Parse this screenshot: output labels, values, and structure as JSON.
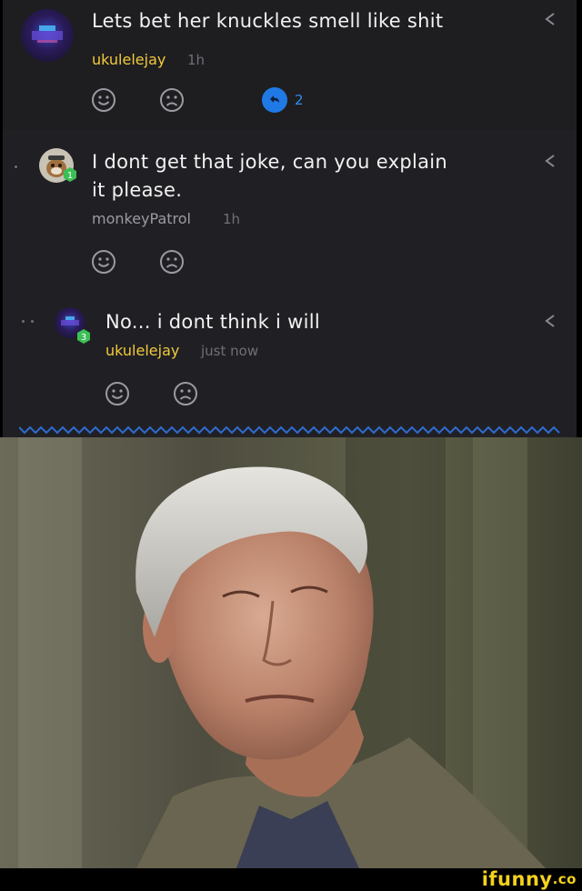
{
  "comments": [
    {
      "text": "Lets bet her knuckles smell like shit",
      "username": "ukulelejay",
      "time": "1h",
      "reply_count": "2"
    },
    {
      "text_line1": "I dont get that joke, can you explain",
      "text_line2": "it please.",
      "username": "monkeyPatrol",
      "time": "1h",
      "level": "1"
    },
    {
      "text": "No... i dont think i will",
      "username": "ukulelejay",
      "time": "just now",
      "level": "3"
    }
  ],
  "watermark": {
    "text": "ifunny",
    "suffix": ".co"
  },
  "icons": {
    "share": "share-icon",
    "smile": "smile-icon",
    "frown": "frown-icon",
    "reply": "reply-icon"
  },
  "colors": {
    "username_gold": "#f2c93a",
    "username_gray": "#9a9aa2",
    "reply_blue": "#1f7ae6",
    "level_green": "#3cbf54",
    "watermark_yellow": "#f4d21d"
  }
}
